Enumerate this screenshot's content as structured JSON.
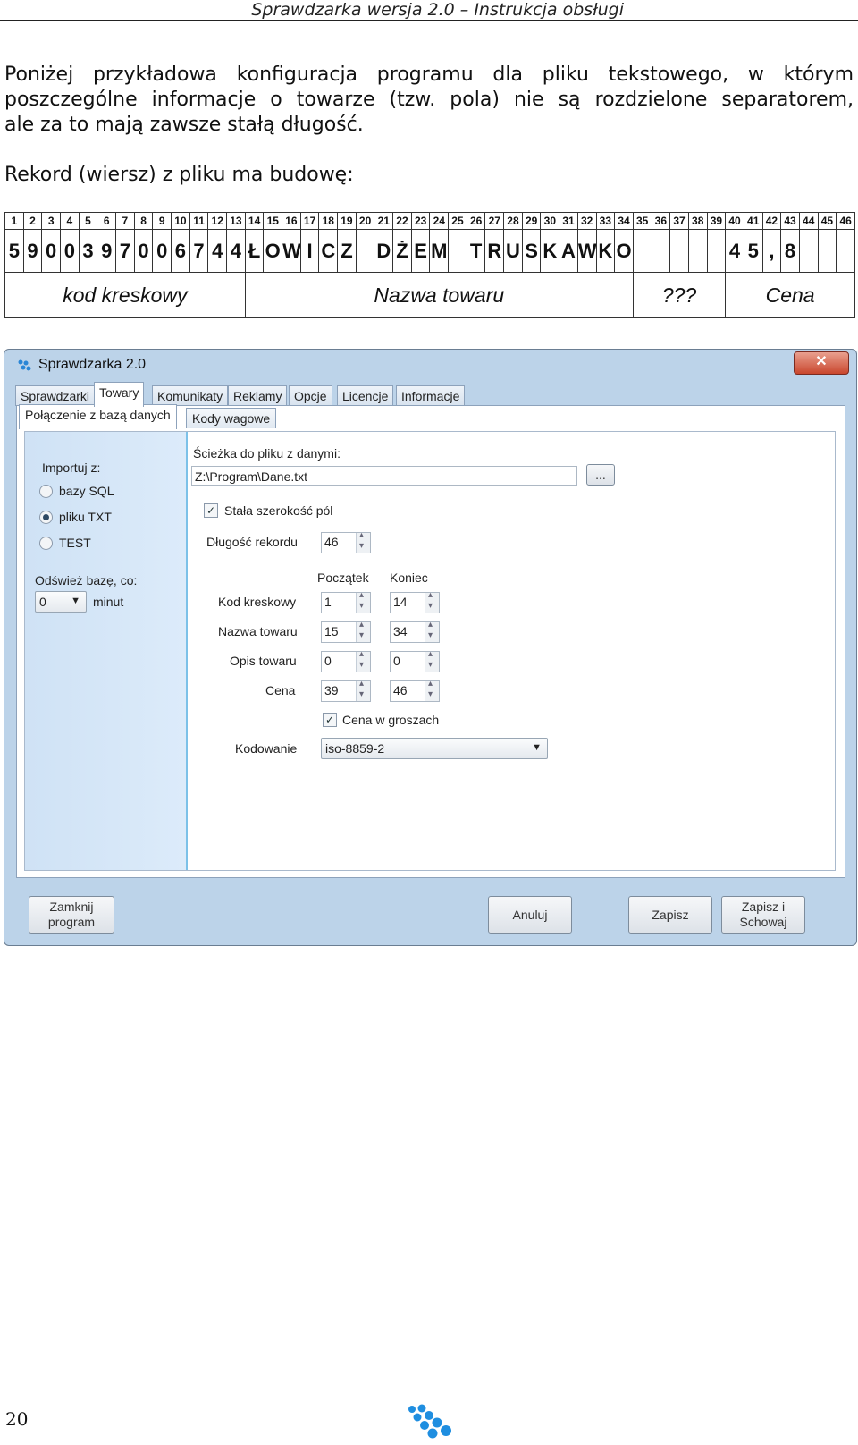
{
  "header": {
    "title": "Sprawdzarka wersja 2.0   – Instrukcja obsługi"
  },
  "intro": {
    "line1": "Poniżej przykładowa konfiguracja programu dla pliku tekstowego, w którym",
    "line2": "poszczególne informacje o towarze (tzw. pola) nie są rozdzielone separatorem,",
    "line3": "ale za to mają zawsze stałą długość.",
    "record_heading": "Rekord (wiersz) z pliku ma budowę:"
  },
  "record": {
    "positions": [
      "1",
      "2",
      "3",
      "4",
      "5",
      "6",
      "7",
      "8",
      "9",
      "10",
      "11",
      "12",
      "13",
      "14",
      "15",
      "16",
      "17",
      "18",
      "19",
      "20",
      "21",
      "22",
      "23",
      "24",
      "25",
      "26",
      "27",
      "28",
      "29",
      "30",
      "31",
      "32",
      "33",
      "34",
      "35",
      "36",
      "37",
      "38",
      "39",
      "40",
      "41",
      "42",
      "43",
      "44",
      "45",
      "46"
    ],
    "chars": [
      "5",
      "9",
      "0",
      "0",
      "3",
      "9",
      "7",
      "0",
      "0",
      "6",
      "7",
      "4",
      "4",
      "Ł",
      "O",
      "W",
      "I",
      "C",
      "Z",
      "",
      "D",
      "Ż",
      "E",
      "M",
      "",
      "T",
      "R",
      "U",
      "S",
      "K",
      "A",
      "W",
      "K",
      "O",
      "",
      "",
      "",
      "",
      "",
      "4",
      "5",
      ",",
      "8",
      "",
      "",
      ""
    ],
    "fields": [
      {
        "label": "kod kreskowy",
        "span": 13
      },
      {
        "label": "Nazwa towaru",
        "span": 21
      },
      {
        "label": "???",
        "span": 5
      },
      {
        "label": "Cena",
        "span": 7
      }
    ]
  },
  "window": {
    "title": "Sprawdzarka 2.0",
    "close": "✕",
    "tabs": [
      "Sprawdzarki",
      "Towary",
      "Komunikaty",
      "Reklamy",
      "Opcje",
      "Licencje",
      "Informacje"
    ],
    "subtabs": [
      "Połączenie z bazą danych",
      "Kody wagowe"
    ],
    "import_label": "Importuj z:",
    "import_options": [
      "bazy SQL",
      "pliku TXT",
      "TEST"
    ],
    "refresh_label": "Odśwież bazę, co:",
    "refresh_value": "0",
    "refresh_unit": "minut",
    "path_label": "Ścieżka do pliku z danymi:",
    "path_value": "Z:\\Program\\Dane.txt",
    "browse": "...",
    "fixed_width_label": "Stała szerokość pól",
    "record_length_label": "Długość rekordu",
    "record_length_value": "46",
    "col_start": "Początek",
    "col_end": "Koniec",
    "fields": [
      {
        "label": "Kod kreskowy",
        "start": "1",
        "end": "14"
      },
      {
        "label": "Nazwa towaru",
        "start": "15",
        "end": "34"
      },
      {
        "label": "Opis towaru",
        "start": "0",
        "end": "0"
      },
      {
        "label": "Cena",
        "start": "39",
        "end": "46"
      }
    ],
    "grosz_label": "Cena w groszach",
    "encoding_label": "Kodowanie",
    "encoding_value": "iso-8859-2",
    "buttons": {
      "close_program": "Zamknij program",
      "cancel": "Anuluj",
      "save": "Zapisz",
      "save_close": "Zapisz i Schowaj"
    }
  },
  "page_number": "20",
  "colors": {
    "accent": "#2a86d6",
    "window_bg": "#bcd3e9",
    "panel_blue": "#cfe2f5"
  }
}
